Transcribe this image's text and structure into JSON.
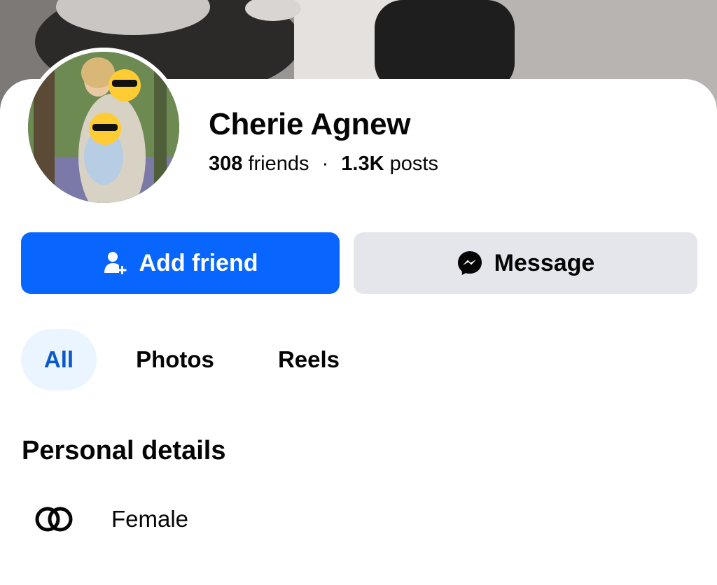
{
  "profile": {
    "name": "Cherie Agnew",
    "friends_count": "308",
    "friends_label": "friends",
    "separator": "·",
    "posts_count": "1.3K",
    "posts_label": "posts"
  },
  "actions": {
    "add_friend_label": "Add friend",
    "add_friend_icon": "add-person-icon",
    "message_label": "Message",
    "message_icon": "messenger-icon"
  },
  "tabs": [
    {
      "label": "All",
      "active": true
    },
    {
      "label": "Photos",
      "active": false
    },
    {
      "label": "Reels",
      "active": false
    }
  ],
  "personal_details": {
    "title": "Personal details",
    "items": [
      {
        "icon": "gender-rings-icon",
        "text": "Female"
      }
    ]
  },
  "colors": {
    "primary": "#0866ff",
    "secondary_button": "#e4e6eb",
    "active_tab_bg": "#ebf5ff",
    "active_tab_text": "#0a58c9"
  }
}
